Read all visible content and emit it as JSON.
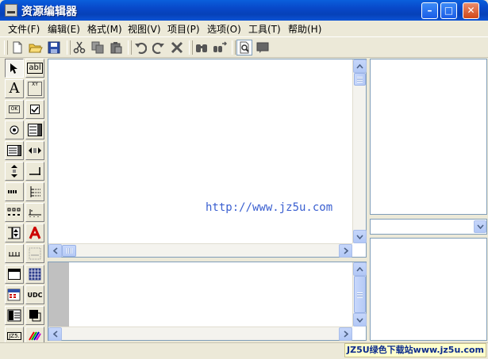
{
  "window": {
    "title": "资源编辑器",
    "controls": {
      "minimize": "–",
      "maximize": "□",
      "close": "✕"
    }
  },
  "menu": [
    {
      "label": "文件(F)"
    },
    {
      "label": "编辑(E)"
    },
    {
      "label": "格式(M)"
    },
    {
      "label": "视图(V)"
    },
    {
      "label": "项目(P)"
    },
    {
      "label": "选项(O)"
    },
    {
      "label": "工具(T)"
    },
    {
      "label": "帮助(H)"
    }
  ],
  "toolbar": [
    "new-file-icon",
    "open-folder-icon",
    "save-icon",
    "cut-icon",
    "copy-icon",
    "paste-icon",
    "undo-icon",
    "redo-icon",
    "delete-icon",
    "find-icon",
    "replace-icon",
    "preview-icon",
    "comment-icon"
  ],
  "palette": {
    "edit_text_label": "abl",
    "static_text_label": "A",
    "group_label": "XY",
    "button_label": "OK",
    "udc_label": "UDC",
    "jz_label": "JZ5."
  },
  "editor": {
    "watermark_url": "http://www.jz5u.com"
  },
  "colors": {
    "titlebar": "#0A5FDC",
    "panel_border": "#7F9DB9",
    "scrollbar_button": "#C6D6FA",
    "url_text": "#3A5FD0"
  },
  "statusbar": {
    "brand": "JZ5U绿色下载站www.jz5u.com"
  }
}
